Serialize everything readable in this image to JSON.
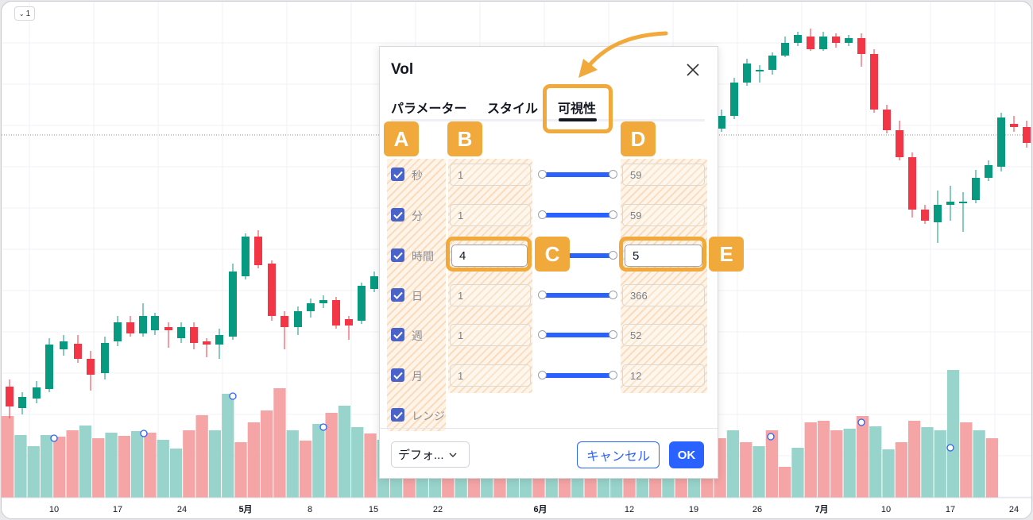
{
  "toolbar": {
    "interval_label": "1"
  },
  "dialog": {
    "title": "Vol",
    "tabs": [
      {
        "label": "パラメーター"
      },
      {
        "label": "スタイル"
      },
      {
        "label": "可視性"
      }
    ],
    "active_tab": "可視性",
    "rows": [
      {
        "label": "秒",
        "checked": true,
        "from": "1",
        "to": "59"
      },
      {
        "label": "分",
        "checked": true,
        "from": "1",
        "to": "59"
      },
      {
        "label": "時間",
        "checked": true,
        "from": "4",
        "to": "5"
      },
      {
        "label": "日",
        "checked": true,
        "from": "1",
        "to": "366"
      },
      {
        "label": "週",
        "checked": true,
        "from": "1",
        "to": "52"
      },
      {
        "label": "月",
        "checked": true,
        "from": "1",
        "to": "12"
      },
      {
        "label": "レンジ",
        "checked": true
      }
    ],
    "footer": {
      "defaults_label": "デフォ...",
      "cancel_label": "キャンセル",
      "ok_label": "OK"
    }
  },
  "callouts": {
    "a": "A",
    "b": "B",
    "c": "C",
    "d": "D",
    "e": "E"
  },
  "xaxis_labels": [
    "10",
    "17",
    "24",
    "5月",
    "8",
    "15",
    "22",
    "6月",
    "12",
    "19",
    "26",
    "7月",
    "10",
    "17",
    "24"
  ],
  "colors": {
    "up": "#089981",
    "down": "#f23645",
    "accent": "#f2a93b",
    "primary": "#2962ff"
  }
}
